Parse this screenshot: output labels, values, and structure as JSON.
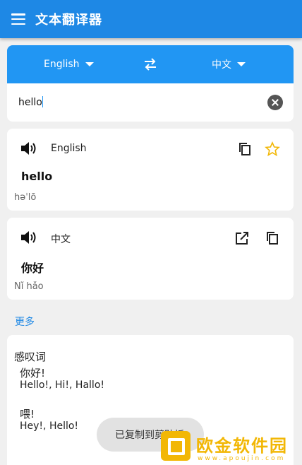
{
  "appbar": {
    "title": "文本翻译器",
    "menu_icon": "hamburger-menu-icon"
  },
  "language_bar": {
    "source_language": "English",
    "target_language": "中文",
    "swap_icon": "swap-arrows-icon"
  },
  "input": {
    "value": "hello",
    "clear_icon": "clear-circle-icon"
  },
  "source_card": {
    "language": "English",
    "word": "hello",
    "phonetic": "həˈlō",
    "icons": [
      "speaker-icon",
      "copy-icon",
      "star-icon"
    ]
  },
  "target_card": {
    "language": "中文",
    "word": "你好",
    "phonetic": "Nǐ hǎo",
    "icons": [
      "speaker-icon",
      "open-external-icon",
      "copy-icon"
    ]
  },
  "more": {
    "label": "更多"
  },
  "definitions": {
    "part_of_speech": "感叹词",
    "entries": [
      {
        "word": "你好!",
        "gloss": "Hello!, Hi!, Hallo!"
      },
      {
        "word": "喂!",
        "gloss": "Hey!, Hello!"
      }
    ]
  },
  "toast": {
    "text": "已复制到剪贴板"
  },
  "watermark": {
    "text": "欧金软件园",
    "url": "www.apoujin.com"
  },
  "colors": {
    "primary": "#1e88e5",
    "lang_bar": "#2196f3",
    "star": "#f2b705",
    "background": "#f0f0f0"
  }
}
